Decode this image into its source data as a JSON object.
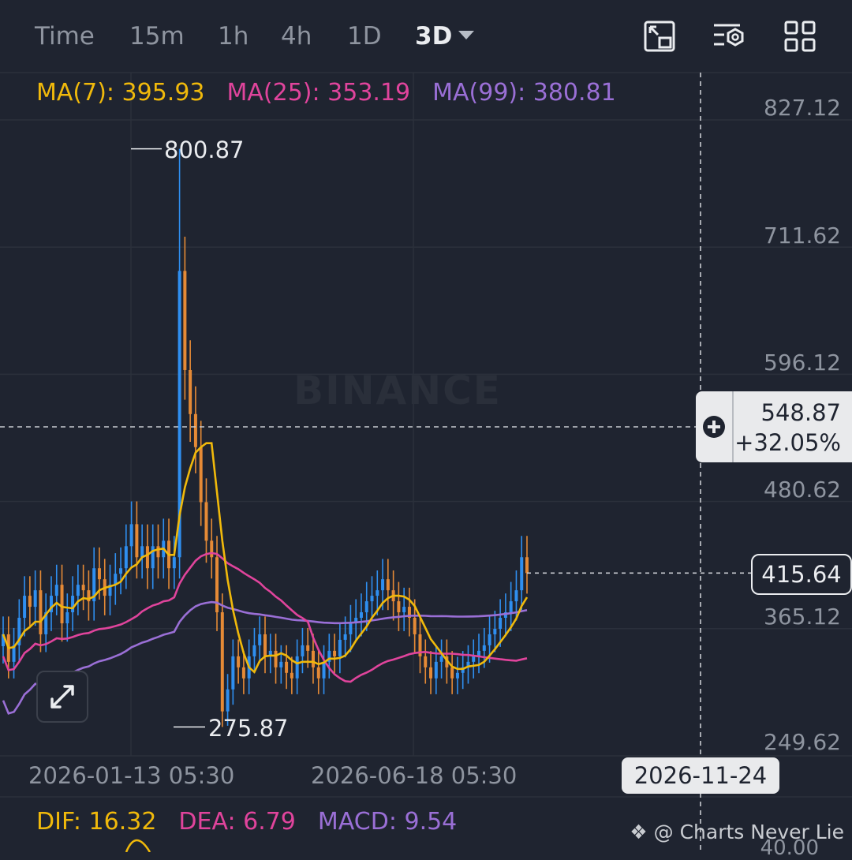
{
  "toolbar": {
    "intervals": [
      "Time",
      "15m",
      "1h",
      "4h",
      "1D",
      "3D"
    ],
    "active_interval": "3D",
    "icons": [
      "fullscreen-icon",
      "indicator-settings-icon",
      "layout-grid-icon"
    ]
  },
  "ma_legend": {
    "ma7": "MA(7): 395.93",
    "ma25": "MA(25): 353.19",
    "ma99": "MA(99): 380.81"
  },
  "watermark": "BINANCE",
  "price_axis": [
    "827.12",
    "711.62",
    "596.12",
    "480.62",
    "365.12",
    "249.62"
  ],
  "annotations": {
    "high": "800.87",
    "low": "275.87"
  },
  "crosshair": {
    "price": "548.87",
    "change": "+32.05%",
    "date": "2026-11-24"
  },
  "last_price": "415.64",
  "time_axis": [
    "2026-01-13 05:30",
    "2026-06-18 05:30"
  ],
  "macd_legend": {
    "dif": "DIF: 16.32",
    "dea": "DEA: 6.79",
    "macd": "MACD: 9.54"
  },
  "macd_axis_partial": "40.00",
  "credit": "@ Charts Never Lie",
  "colors": {
    "background": "#1f2430",
    "up": "#2f8ff0",
    "down": "#e58a36",
    "ma7": "#f0b90b",
    "ma25": "#e0449c",
    "ma99": "#9a6fd6",
    "grid": "#2b303b"
  },
  "chart_data": {
    "type": "candlestick",
    "x_start": "2025-11-12",
    "x_step_days": 3,
    "ylim": [
      249.62,
      827.12
    ],
    "y_ticks": [
      827.12,
      711.62,
      596.12,
      480.62,
      365.12,
      249.62
    ],
    "high": 800.87,
    "low": 275.87,
    "last": 415.64,
    "closes": [
      360,
      335,
      350,
      375,
      395,
      385,
      400,
      360,
      380,
      395,
      405,
      370,
      380,
      395,
      405,
      400,
      390,
      420,
      410,
      395,
      405,
      415,
      420,
      440,
      460,
      430,
      440,
      420,
      440,
      430,
      445,
      420,
      430,
      690,
      600,
      560,
      530,
      480,
      445,
      430,
      380,
      290,
      310,
      340,
      330,
      320,
      340,
      350,
      360,
      340,
      345,
      330,
      335,
      325,
      320,
      340,
      350,
      345,
      330,
      320,
      335,
      345,
      340,
      355,
      360,
      370,
      375,
      380,
      390,
      395,
      400,
      410,
      400,
      390,
      380,
      385,
      375,
      360,
      340,
      330,
      320,
      335,
      340,
      330,
      320,
      325,
      330,
      335,
      340,
      345,
      350,
      360,
      365,
      375,
      380,
      390,
      400,
      430,
      415.64
    ]
  }
}
